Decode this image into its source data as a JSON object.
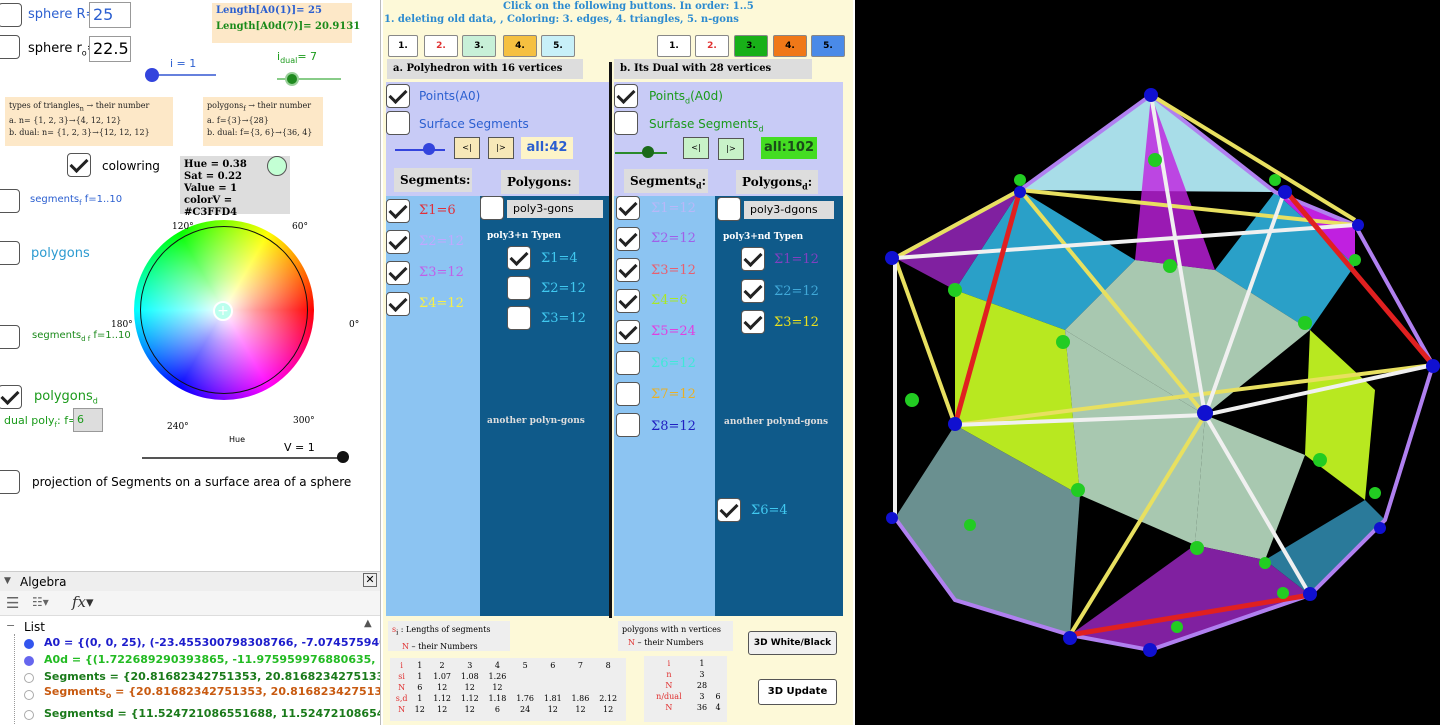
{
  "left": {
    "sphere_R_label": "sphere R=",
    "sphere_R_value": "25",
    "sphere_r0_label": "sphere  r",
    "sphere_r0_sub": "o",
    "sphere_r0_eq": "=",
    "sphere_r0_value": "22.5",
    "length_a0": "Length[A0(1)]= 25",
    "length_a0d": "Length[A0d(7)]= 20.9131",
    "i_slider_label": "i = 1",
    "idual_label": "i",
    "idual_sub": "dual",
    "idual_value": "= 7",
    "tri_box": {
      "line1": "types of triangles",
      "line1b": "n",
      "line1c": " → their number",
      "line2": "a.        n= {1, 2, 3}→{4, 12, 12}",
      "line3": "b. dual: n= {1, 2, 3}→{12, 12, 12}"
    },
    "poly_box": {
      "line1": "polygons",
      "line1b": "f",
      "line1c": " → their number",
      "line2": "a.        f={3}→{28}",
      "line3": "b. dual: f={3, 6}→{36, 4}"
    },
    "colowring": "colowring",
    "hsv": {
      "hue": "Hue = 0.38",
      "sat": "Sat = 0.22",
      "value": "Value = 1",
      "color": "colorV = #C3FFD4"
    },
    "segments_f": "segments",
    "segments_f_sub": "f",
    "segments_f_range": " f=1..10",
    "polygons": "polygons",
    "segments_df": "segments",
    "segments_df_sub": "d f",
    "segments_df_range": " f=1..10",
    "polygons_d": "polygons",
    "polygons_d_sub": "d",
    "dual_poly_label": "dual poly",
    "dual_poly_sub": "f",
    "dual_poly_eq": ": f=",
    "dual_poly_value": "6",
    "wheel": {
      "a120": "120°",
      "a60": "60°",
      "a180": "180°",
      "a0": "0°",
      "a240": "240°",
      "a300": "300°",
      "hue": "Hue",
      "v": "V = 1"
    },
    "projection": "projection of Segments on a surface area of a sphere"
  },
  "algebra": {
    "title": "Algebra",
    "list_label": "List",
    "rows": [
      {
        "text": "A0 = {(0, 0, 25), (-23.455300798308766, -7.0745759403131",
        "color": "#1d1dcc"
      },
      {
        "text": "A0d = {(1.722689290393865, -11.975959976880635, 17.0",
        "color": "#22bb22"
      },
      {
        "text": "Segments = {20.81682342751353, 20.816823427513363",
        "color": "#1a7a1a"
      },
      {
        "text": "Segments",
        "sub": "o",
        "rest": " = {20.81682342751353, 20.81682342751336",
        "color": "#c85a10"
      },
      {
        "text": "Segmentsd = {11.524721086551688, 11.524721086547",
        "color": "#1a7a1a"
      }
    ]
  },
  "mid": {
    "instr1": "Click on the following buttons. In order: 1..5",
    "instr2": "1. deleting old data,     , Coloring: 3. edges, 4. triangles, 5. n-gons",
    "btns_left": [
      "1.",
      "2.",
      "3.",
      "4.",
      "5."
    ],
    "btns_right": [
      "1.",
      "2.",
      "3.",
      "4.",
      "5."
    ],
    "sec_a": "a. Polyhedron with 16 vertices",
    "sec_b": "b. Its Dual with 28  vertices",
    "points_a0": "Points(A0)",
    "surface_segments": "Surface Segments",
    "points_d": "Points",
    "points_d_sub": "d",
    "points_d_rest": "(A0d)",
    "surfase_segments_d": "Surfase Segments",
    "surfase_sub": "d",
    "nav_prev": "<|",
    "nav_next": "|>",
    "all_a": "all:42",
    "all_b": "all:102",
    "segments_hdr": "Segments:",
    "polygons_hdr": "Polygons:",
    "segments_d_hdr": "Segments",
    "segments_d_sub": "d",
    "polygons_d_hdr": "Polygons",
    "polygons_d_sub": "d",
    "sigma_a": [
      "Σ1=6",
      "Σ2=12",
      "Σ3=12",
      "Σ4=12"
    ],
    "sigma_a_colors": [
      "#e0303a",
      "#c0a8ff",
      "#c060e8",
      "#f8f048"
    ],
    "poly3_gons": "poly3-gons",
    "poly3n_typen": "poly3+n   Typen",
    "typen_a": [
      "Σ1=4",
      "Σ2=12",
      "Σ3=12"
    ],
    "another_a": "another polyn-gons",
    "sigma_b": [
      "Σ1=12",
      "Σ2=12",
      "Σ3=12",
      "Σ4=6",
      "Σ5=24",
      "Σ6=12",
      "Σ7=12",
      "Σ8=12"
    ],
    "sigma_b_colors": [
      "#b8b8f8",
      "#a060e8",
      "#e86070",
      "#a8e828",
      "#e040e0",
      "#40e8d8",
      "#e8b028",
      "#2020c0"
    ],
    "poly3_dgons": "poly3-dgons",
    "poly3nd_typen": "poly3+nd   Typen",
    "typen_b": [
      "Σ1=12",
      "Σ2=12",
      "Σ3=12"
    ],
    "typen_b_colors": [
      "#8040c0",
      "#40a8d8",
      "#e8e020"
    ],
    "another_b": "another polynd-gons",
    "sigma6": "Σ6=4",
    "legend_a_1": "s",
    "legend_a_1b": "i",
    "legend_a_1c": " :  Lengths of segments",
    "legend_a_2": "N",
    "legend_a_2b": " – their Numbers",
    "legend_b_1": "polygons with n vertices",
    "legend_b_2": "N",
    "legend_b_2b": " – their Numbers",
    "btn_3d_wb": "3D White/Black",
    "btn_3d_update": "3D Update",
    "table_a": {
      "rows": [
        [
          "i",
          "1",
          "2",
          "3",
          "4",
          "5",
          "6",
          "7",
          "8"
        ],
        [
          "si",
          "1",
          "1.07",
          "1.08",
          "1.26",
          "",
          "",
          "",
          ""
        ],
        [
          "N",
          "6",
          "12",
          "12",
          "12",
          "",
          "",
          "",
          ""
        ],
        [
          "s,d",
          "1",
          "1.12",
          "1.12",
          "1.18",
          "1.76",
          "1.81",
          "1.86",
          "2.12"
        ],
        [
          "N",
          "12",
          "12",
          "12",
          "6",
          "24",
          "12",
          "12",
          "12"
        ]
      ]
    },
    "table_b": {
      "rows": [
        [
          "i",
          "1",
          ""
        ],
        [
          "n",
          "3",
          ""
        ],
        [
          "N",
          "28",
          ""
        ],
        [
          "n/dual",
          "3",
          "6"
        ],
        [
          "N",
          "36",
          "4"
        ]
      ]
    }
  },
  "colors": {
    "lavender": "#c8cbf6",
    "light_blue": "#8cc4f2",
    "dark_blue": "#0f5a8a",
    "cream": "#fdf9d8"
  }
}
